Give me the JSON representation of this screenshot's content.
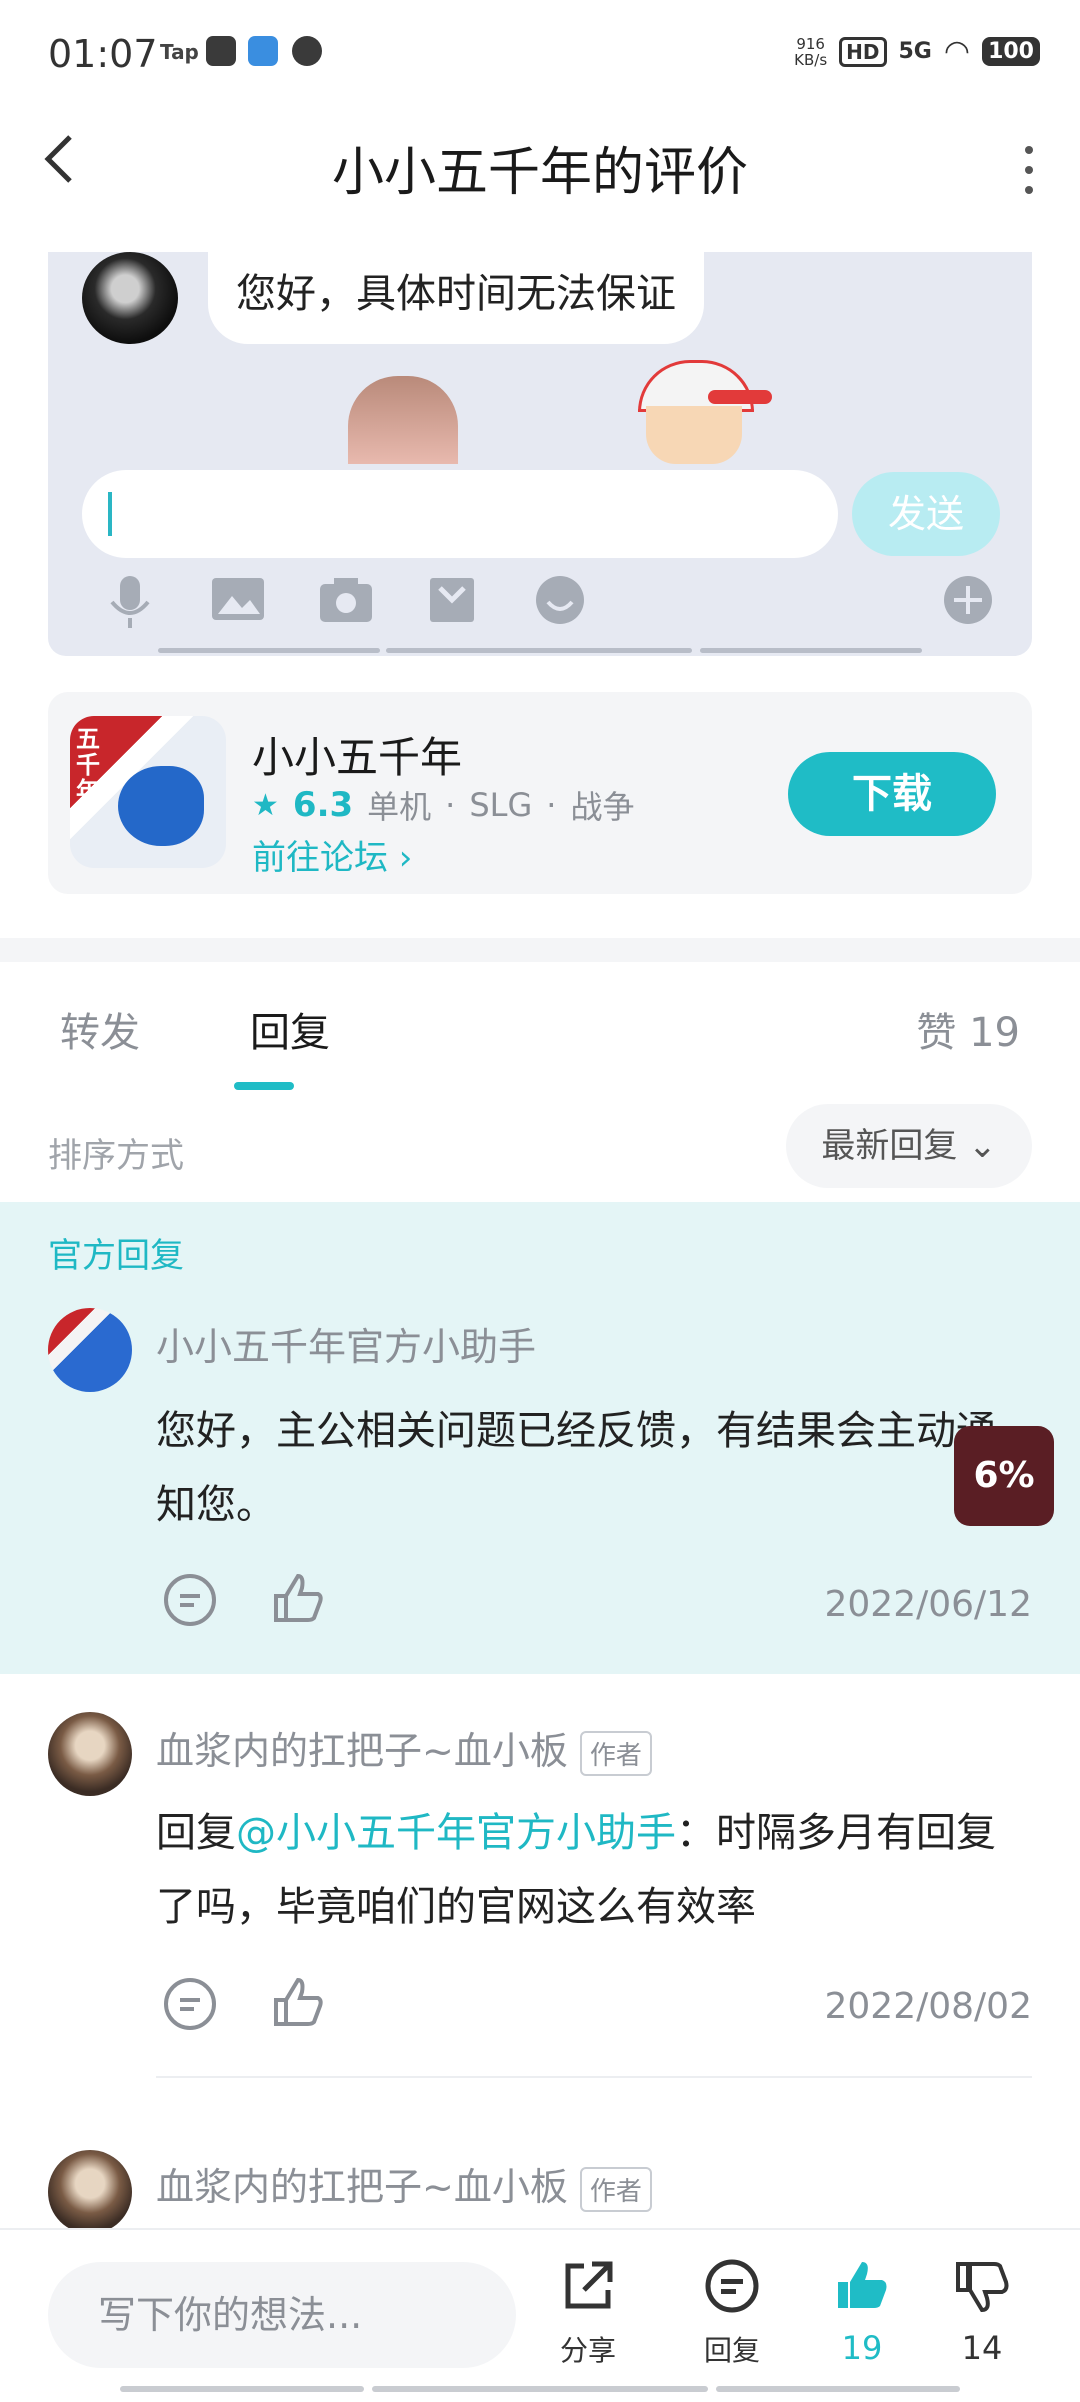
{
  "status_bar": {
    "time": "01:07",
    "app_label": "Tap",
    "net_speed_value": "916",
    "net_speed_unit": "KB/s",
    "hd": "HD",
    "signal": "5G",
    "battery": "100"
  },
  "header": {
    "back_icon": "chevron-left",
    "title": "小小五千年的评价",
    "more_icon": "vertical-dots"
  },
  "chat_preview": {
    "bubble_text": "您好，具体时间无法保证",
    "send_label": "发送",
    "toolbar_icons": [
      "mic-icon",
      "image-icon",
      "camera-icon",
      "package-icon",
      "emoji-icon",
      "plus-icon"
    ]
  },
  "app_card": {
    "name": "小小五千年",
    "rating": "6.3",
    "meta": [
      "单机",
      "SLG",
      "战争"
    ],
    "forum_link": "前往论坛 ›",
    "download_label": "下载",
    "accent": "#1fbcc6"
  },
  "tabs": {
    "forward": "转发",
    "reply": "回复",
    "likes": "赞 19"
  },
  "sort": {
    "label": "排序方式",
    "value": "最新回复 ⌄"
  },
  "official_reply": {
    "label": "官方回复",
    "author": "小小五千年官方小助手",
    "text": "您好，主公相关问题已经反馈，有结果会主动通知您。",
    "date": "2022/06/12",
    "floating_badge": "6%"
  },
  "replies": [
    {
      "author": "血浆内的扛把子~血小板",
      "tag": "作者",
      "prefix": "回复",
      "mention": "@小小五千年官方小助手",
      "text": "：时隔多月有回复了吗，毕竟咱们的官网这么有效率",
      "date": "2022/08/02"
    },
    {
      "author": "血浆内的扛把子~血小板",
      "tag": "作者"
    }
  ],
  "bottom_bar": {
    "placeholder": "写下你的想法...",
    "share_label": "分享",
    "reply_label": "回复",
    "like_count": "19",
    "dislike_count": "14"
  }
}
